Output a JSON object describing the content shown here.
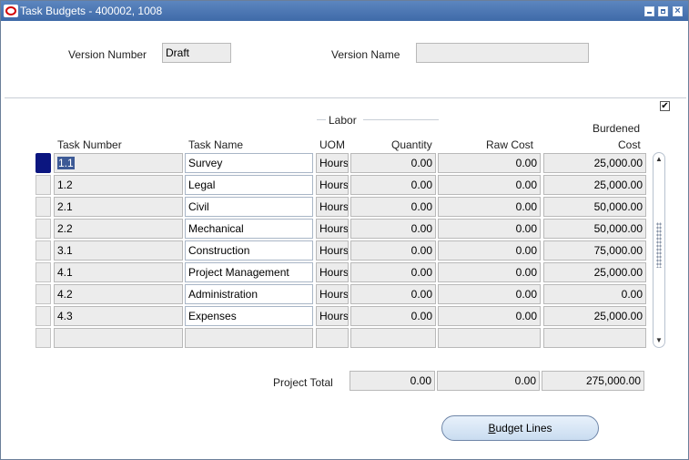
{
  "window": {
    "title": "Task Budgets - 400002, 1008"
  },
  "header": {
    "version_number_label": "Version Number",
    "version_number_value": "Draft",
    "version_name_label": "Version Name",
    "version_name_value": ""
  },
  "grid": {
    "group_label": "Labor",
    "columns": {
      "task_number": "Task Number",
      "task_name": "Task Name",
      "uom": "UOM",
      "quantity": "Quantity",
      "raw_cost": "Raw Cost",
      "burdened_cost_line1": "Burdened",
      "burdened_cost_line2": "Cost"
    },
    "rows": [
      {
        "task_number": "1.1",
        "task_name": "Survey",
        "uom": "Hours",
        "quantity": "0.00",
        "raw_cost": "0.00",
        "burdened_cost": "25,000.00"
      },
      {
        "task_number": "1.2",
        "task_name": "Legal",
        "uom": "Hours",
        "quantity": "0.00",
        "raw_cost": "0.00",
        "burdened_cost": "25,000.00"
      },
      {
        "task_number": "2.1",
        "task_name": "Civil",
        "uom": "Hours",
        "quantity": "0.00",
        "raw_cost": "0.00",
        "burdened_cost": "50,000.00"
      },
      {
        "task_number": "2.2",
        "task_name": "Mechanical",
        "uom": "Hours",
        "quantity": "0.00",
        "raw_cost": "0.00",
        "burdened_cost": "50,000.00"
      },
      {
        "task_number": "3.1",
        "task_name": "Construction",
        "uom": "Hours",
        "quantity": "0.00",
        "raw_cost": "0.00",
        "burdened_cost": "75,000.00"
      },
      {
        "task_number": "4.1",
        "task_name": "Project Management",
        "uom": "Hours",
        "quantity": "0.00",
        "raw_cost": "0.00",
        "burdened_cost": "25,000.00"
      },
      {
        "task_number": "4.2",
        "task_name": "Administration",
        "uom": "Hours",
        "quantity": "0.00",
        "raw_cost": "0.00",
        "burdened_cost": "0.00"
      },
      {
        "task_number": "4.3",
        "task_name": "Expenses",
        "uom": "Hours",
        "quantity": "0.00",
        "raw_cost": "0.00",
        "burdened_cost": "25,000.00"
      },
      {
        "task_number": "",
        "task_name": "",
        "uom": "",
        "quantity": "",
        "raw_cost": "",
        "burdened_cost": ""
      }
    ]
  },
  "totals": {
    "label": "Project Total",
    "quantity": "0.00",
    "raw_cost": "0.00",
    "burdened_cost": "275,000.00"
  },
  "actions": {
    "budget_lines_mnemonic": "B",
    "budget_lines_rest": "udget Lines"
  }
}
